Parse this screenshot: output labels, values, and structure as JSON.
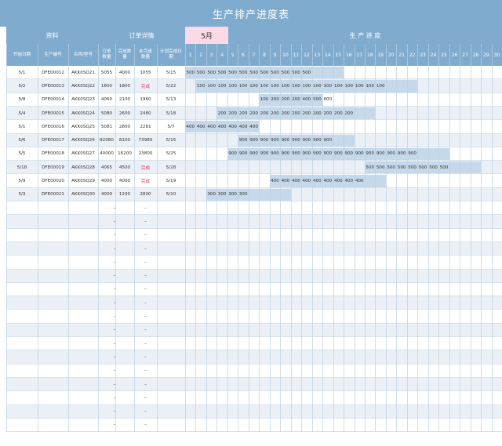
{
  "title": "生产排产进度表",
  "group_headers": {
    "info": "资料",
    "order": "订单详情",
    "month": "5月",
    "progress": "生 产 进 度"
  },
  "columns": {
    "start_date": "开始日期",
    "prod_no": "生产编号",
    "model": "名称/型号",
    "order_qty": "订单数量",
    "done_qty": "完成数量",
    "undone_qty": "未完成数量",
    "plan_date": "计划完成日期"
  },
  "days": [
    "1",
    "2",
    "3",
    "4",
    "5",
    "6",
    "7",
    "8",
    "9",
    "10",
    "11",
    "12",
    "13",
    "14",
    "15",
    "16",
    "17",
    "18",
    "19",
    "20",
    "21",
    "22",
    "23",
    "24",
    "25",
    "26",
    "27",
    "28",
    "29",
    "30"
  ],
  "rows": [
    {
      "start": "5/1",
      "no": "DFE00012",
      "model": "AKK0SQ21",
      "order": "5055",
      "done": "4000",
      "undone": "1055",
      "plan": "5/15",
      "bar_start": 1,
      "bar_end": 15,
      "daily": "500",
      "filled": 12
    },
    {
      "start": "5/2",
      "no": "DFE00013",
      "model": "AKK0SQ22",
      "order": "1800",
      "done": "1800",
      "undone": "完成",
      "plan": "5/22",
      "bar_start": 2,
      "bar_end": 22,
      "daily": "100",
      "filled": 18
    },
    {
      "start": "5/8",
      "no": "DFE00014",
      "model": "AKK0SQ23",
      "order": "4060",
      "done": "2100",
      "undone": "1960",
      "plan": "5/13",
      "bar_start": 8,
      "bar_end": 13,
      "daily": "",
      "filled": 0
    },
    {
      "start": "5/4",
      "no": "DFE00015",
      "model": "AKK0SQ24",
      "order": "5080",
      "done": "2600",
      "undone": "2480",
      "plan": "5/18",
      "bar_start": 4,
      "bar_end": 18,
      "daily": "200",
      "filled": 13
    },
    {
      "start": "5/1",
      "no": "DFE00016",
      "model": "AKK0SQ25",
      "order": "5081",
      "done": "2800",
      "undone": "2281",
      "plan": "5/7",
      "bar_start": 1,
      "bar_end": 7,
      "daily": "400",
      "filled": 7
    },
    {
      "start": "5/6",
      "no": "DFE00017",
      "model": "AKK0SQ26",
      "order": "82080",
      "done": "8100",
      "undone": "73980",
      "plan": "5/16",
      "bar_start": 6,
      "bar_end": 16,
      "daily": "900",
      "filled": 9
    },
    {
      "start": "5/5",
      "no": "DFE00018",
      "model": "AKK0SQ27",
      "order": "40000",
      "done": "16200",
      "undone": "23800",
      "plan": "5/25",
      "bar_start": 5,
      "bar_end": 25,
      "daily": "900",
      "filled": 18
    },
    {
      "start": "5/18",
      "no": "DFE00019",
      "model": "AKK0SQ28",
      "order": "4065",
      "done": "4500",
      "undone": "完成",
      "plan": "5/28",
      "bar_start": 18,
      "bar_end": 28,
      "daily": "500",
      "filled": 8
    },
    {
      "start": "5/9",
      "no": "DFE00020",
      "model": "AKK0SQ29",
      "order": "4000",
      "done": "4000",
      "undone": "完成",
      "plan": "5/19",
      "bar_start": 9,
      "bar_end": 19,
      "daily": "400",
      "filled": 9
    },
    {
      "start": "5/3",
      "no": "DFE00021",
      "model": "AKK0SQ30",
      "order": "4000",
      "done": "1200",
      "undone": "2800",
      "plan": "5/10",
      "bar_start": 3,
      "bar_end": 10,
      "daily": "300",
      "filled": 4
    }
  ],
  "row14_values": [
    "100",
    "200",
    "200",
    "200",
    "400",
    "500",
    "600"
  ],
  "empty_row_dash": "–",
  "empty_row_count": 17,
  "colors": {
    "header": "#7fabcf",
    "month": "#fbd9e5",
    "bar": "#c5d9ea",
    "band": "#eaf0f6",
    "complete": "#d6375a"
  }
}
